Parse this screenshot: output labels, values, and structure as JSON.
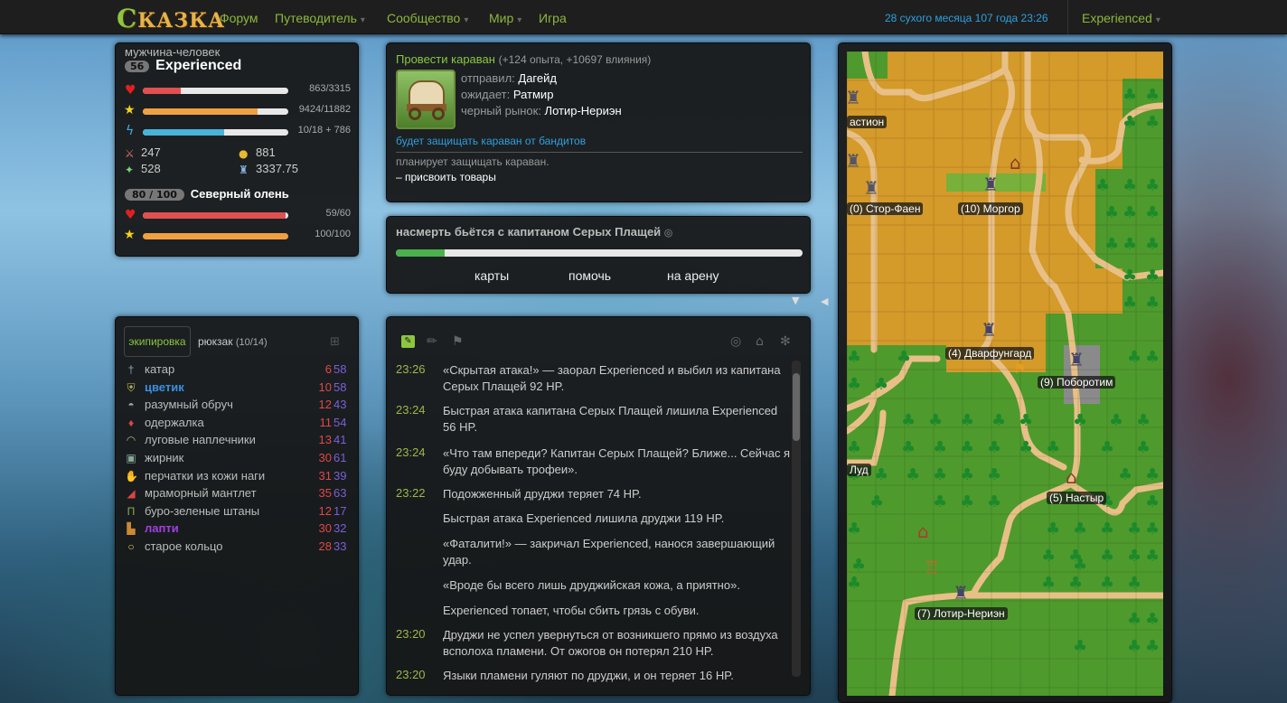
{
  "nav": {
    "logo": "Сказка",
    "items": [
      {
        "label": "Форум",
        "caret": false
      },
      {
        "label": "Путеводитель",
        "caret": true
      },
      {
        "label": "Сообщество",
        "caret": true
      },
      {
        "label": "Мир",
        "caret": true
      },
      {
        "label": "Игра",
        "caret": false
      }
    ],
    "date": "28 сухого месяца 107 года 23:26",
    "account": "Experienced"
  },
  "hero": {
    "race": "мужчина-человек",
    "level": "56",
    "name": "Experienced",
    "health": {
      "text": "863/3315",
      "fraction": 0.26
    },
    "experience": {
      "text": "9424/11882",
      "fraction": 0.79
    },
    "energy": {
      "text": "10/18 + 786",
      "fraction": 0.56
    },
    "power_physic": "247",
    "power_magic": "528",
    "money": "881",
    "might": "3337.75",
    "companion": {
      "coherence": "80 / 100",
      "name": "Северный олень",
      "health": {
        "text": "59/60",
        "fraction": 0.98
      },
      "experience": {
        "text": "100/100",
        "fraction": 1.0
      }
    }
  },
  "quest": {
    "title": "Провести караван",
    "reward": "(+124 опыта, +10697 влияния)",
    "lines": [
      {
        "role": "отправил:",
        "name": "Дагейд"
      },
      {
        "role": "ожидает:",
        "name": "Ратмир"
      },
      {
        "role": "черный рынок:",
        "name": "Лотир-Нериэн"
      }
    ],
    "choice": "будет защищать караван от бандитов",
    "status": "планирует защищать караван.",
    "subtask": "– присвоить товары"
  },
  "action": {
    "text": "насмерть бьётся с капитаном Серых Плащей",
    "progress": 0.12,
    "buttons": [
      "карты",
      "помочь",
      "на арену"
    ]
  },
  "equipment": {
    "tab_active": "экипировка",
    "tab_bag": "рюкзак",
    "bag_count": "(10/14)",
    "items": [
      {
        "name": "катар",
        "a": "6",
        "b": "58",
        "icon": "sword-icon",
        "highlight": ""
      },
      {
        "name": "цветик",
        "a": "10",
        "b": "58",
        "icon": "shield-icon",
        "highlight": "blue"
      },
      {
        "name": "разумный обруч",
        "a": "12",
        "b": "43",
        "icon": "helmet-icon",
        "highlight": ""
      },
      {
        "name": "одержалка",
        "a": "11",
        "b": "54",
        "icon": "amulet-icon",
        "highlight": ""
      },
      {
        "name": "луговые наплечники",
        "a": "13",
        "b": "41",
        "icon": "shoulders-icon",
        "highlight": ""
      },
      {
        "name": "жирник",
        "a": "30",
        "b": "61",
        "icon": "armor-icon",
        "highlight": ""
      },
      {
        "name": "перчатки из кожи наги",
        "a": "31",
        "b": "39",
        "icon": "gloves-icon",
        "highlight": ""
      },
      {
        "name": "мраморный мантлет",
        "a": "35",
        "b": "63",
        "icon": "cloak-icon",
        "highlight": ""
      },
      {
        "name": "буро-зеленые штаны",
        "a": "12",
        "b": "17",
        "icon": "pants-icon",
        "highlight": ""
      },
      {
        "name": "лапти",
        "a": "30",
        "b": "32",
        "icon": "boots-icon",
        "highlight": "purple"
      },
      {
        "name": "старое кольцо",
        "a": "28",
        "b": "33",
        "icon": "ring-icon",
        "highlight": ""
      }
    ]
  },
  "journal": [
    {
      "time": "23:26",
      "text": "«Скрытая атака!» — заорал Experienced и выбил из капитана Серых Плащей 92 HP."
    },
    {
      "time": "23:24",
      "text": "Быстрая атака капитана Серых Плащей лишила Experienced 56 HP."
    },
    {
      "time": "23:24",
      "text": "«Что там впереди? Капитан Серых Плащей? Ближе... Сейчас я буду добывать трофеи»."
    },
    {
      "time": "23:22",
      "text": "Подожженный друджи теряет 74 HP."
    },
    {
      "time": "",
      "text": "Быстрая атака Experienced лишила друджи 119 HP."
    },
    {
      "time": "",
      "text": "«Фаталити!» — закричал Experienced, нанося завершающий удар."
    },
    {
      "time": "",
      "text": "«Вроде бы всего лишь друджийская кожа, а приятно»."
    },
    {
      "time": "",
      "text": "Experienced топает, чтобы сбить грязь с обуви."
    },
    {
      "time": "23:20",
      "text": "Друджи не успел увернуться от возникшего прямо из воздуха всполоха пламени. От ожогов он потерял 210 HP."
    },
    {
      "time": "23:20",
      "text": "Языки пламени гуляют по друджи, и он теряет 16 HP."
    }
  ],
  "map": {
    "places": [
      "астион",
      "(0) Стор-Фаен",
      "(10) Моргор",
      "(4) Дварфунгард",
      "(9) Поборотим",
      "Луд",
      "(5) Настыр",
      "(7) Лотир-Нериэн"
    ]
  }
}
